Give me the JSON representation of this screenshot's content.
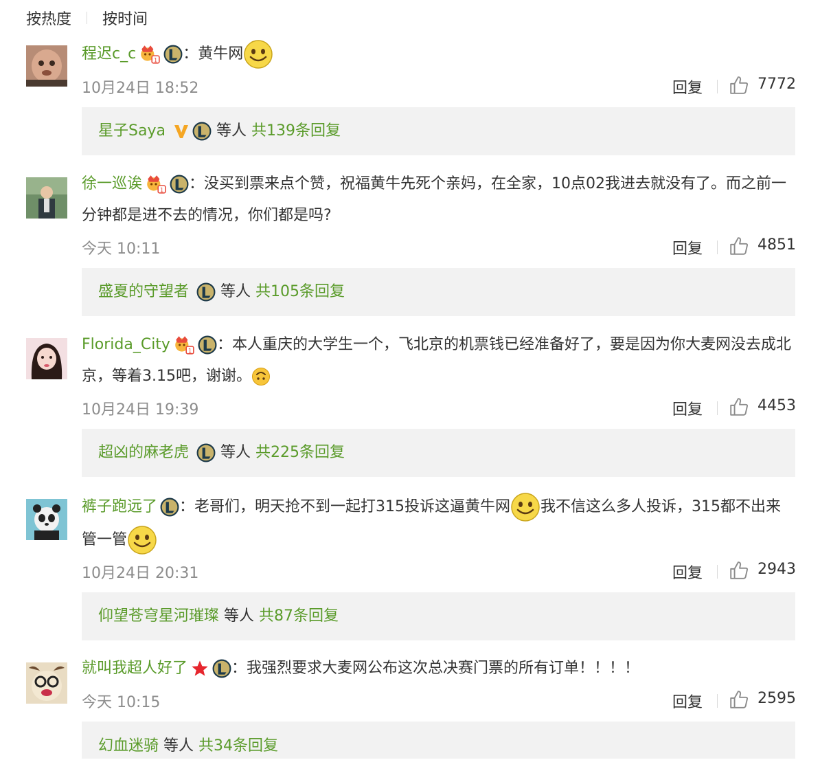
{
  "sort": {
    "hot": "按热度",
    "time": "按时间"
  },
  "labels": {
    "reply": "回复",
    "suffix_prefix": "："
  },
  "colors": {
    "username": "#5a9b2a",
    "thread_bg": "#f2f2f2",
    "meta": "#8c8c8c"
  },
  "comments": [
    {
      "username": "程迟c_c",
      "text": "黄牛网",
      "time": "10月24日 18:52",
      "likes": "7772",
      "thread_user": "星子Saya",
      "thread_mid": "等人",
      "thread_count": "共139条回复"
    },
    {
      "username": "徐一巡诶",
      "text": "没买到票来点个赞，祝福黄牛先死个亲妈，在全家，10点02我进去就没有了。而之前一分钟都是进不去的情况，你们都是吗?",
      "time": "今天 10:11",
      "likes": "4851",
      "thread_user": "盛夏的守望者",
      "thread_mid": "等人",
      "thread_count": "共105条回复"
    },
    {
      "username": "Florida_City",
      "text": "本人重庆的大学生一个，飞北京的机票钱已经准备好了，要是因为你大麦网没去成北京，等着3.15吧，谢谢。",
      "time": "10月24日 19:39",
      "likes": "4453",
      "thread_user": "超凶的麻老虎",
      "thread_mid": "等人",
      "thread_count": "共225条回复"
    },
    {
      "username": "裤子跑远了",
      "text_a": "老哥们，明天抢不到一起打315投诉这逼黄牛网",
      "text_b": "我不信这么多人投诉，315都不出来管一管",
      "time": "10月24日 20:31",
      "likes": "2943",
      "thread_user": "仰望苍穹星河璀璨",
      "thread_mid": "等人",
      "thread_count": "共87条回复"
    },
    {
      "username": "就叫我超人好了",
      "text": "我强烈要求大麦网公布这次总决赛门票的所有订单！！！！",
      "time": "今天 10:15",
      "likes": "2595",
      "thread_user": "幻血迷骑",
      "thread_mid": "等人",
      "thread_count": "共34条回复"
    }
  ]
}
